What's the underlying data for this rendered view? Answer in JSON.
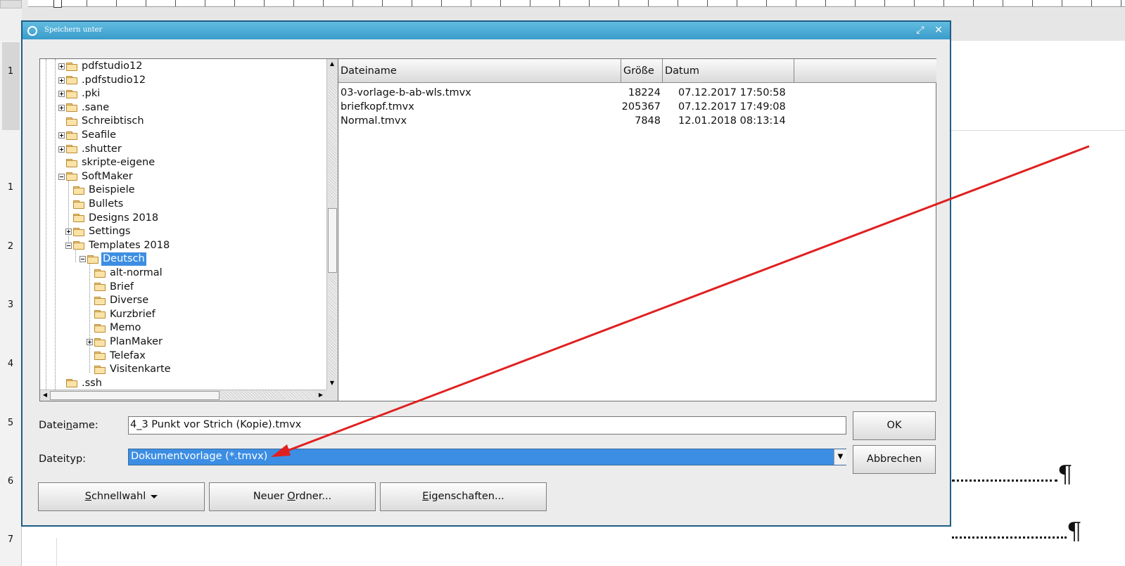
{
  "background": {
    "ruler_left_numbers": [
      "1",
      "1",
      "2",
      "3",
      "4",
      "5",
      "6",
      "7"
    ]
  },
  "dialog": {
    "title": "Speichern unter",
    "tree": {
      "items": [
        {
          "label": "pdfstudio12",
          "level": 0,
          "expander": "plus"
        },
        {
          "label": ".pdfstudio12",
          "level": 0,
          "expander": "plus"
        },
        {
          "label": ".pki",
          "level": 0,
          "expander": "plus"
        },
        {
          "label": ".sane",
          "level": 0,
          "expander": "plus"
        },
        {
          "label": "Schreibtisch",
          "level": 0,
          "expander": "none"
        },
        {
          "label": "Seafile",
          "level": 0,
          "expander": "plus"
        },
        {
          "label": ".shutter",
          "level": 0,
          "expander": "plus"
        },
        {
          "label": "skripte-eigene",
          "level": 0,
          "expander": "none"
        },
        {
          "label": "SoftMaker",
          "level": 0,
          "expander": "minus"
        },
        {
          "label": "Beispiele",
          "level": 1,
          "expander": "none"
        },
        {
          "label": "Bullets",
          "level": 1,
          "expander": "none"
        },
        {
          "label": "Designs 2018",
          "level": 1,
          "expander": "none"
        },
        {
          "label": "Settings",
          "level": 1,
          "expander": "plus"
        },
        {
          "label": "Templates 2018",
          "level": 1,
          "expander": "minus"
        },
        {
          "label": "Deutsch",
          "level": 2,
          "expander": "minus",
          "selected": true
        },
        {
          "label": "alt-normal",
          "level": 3,
          "expander": "none"
        },
        {
          "label": "Brief",
          "level": 3,
          "expander": "none"
        },
        {
          "label": "Diverse",
          "level": 3,
          "expander": "none"
        },
        {
          "label": "Kurzbrief",
          "level": 3,
          "expander": "none"
        },
        {
          "label": "Memo",
          "level": 3,
          "expander": "none"
        },
        {
          "label": "PlanMaker",
          "level": 3,
          "expander": "plus"
        },
        {
          "label": "Telefax",
          "level": 3,
          "expander": "none"
        },
        {
          "label": "Visitenkarte",
          "level": 3,
          "expander": "none"
        },
        {
          "label": ".ssh",
          "level": 0,
          "expander": "none"
        }
      ]
    },
    "filelist": {
      "columns": [
        "Dateiname",
        "Größe",
        "Datum"
      ],
      "rows": [
        {
          "name": "03-vorlage-b-ab-wls.tmvx",
          "size": "18224",
          "date": "07.12.2017 17:50:58"
        },
        {
          "name": "briefkopf.tmvx",
          "size": "205367",
          "date": "07.12.2017 17:49:08"
        },
        {
          "name": "Normal.tmvx",
          "size": "7848",
          "date": "12.01.2018 08:13:14"
        }
      ]
    },
    "form": {
      "filename_label_pre": "Datei",
      "filename_label_u": "n",
      "filename_label_post": "ame:",
      "filename_value": "4_3 Punkt vor Strich (Kopie).tmvx",
      "filetype_label": "Dateityp:",
      "filetype_value": "Dokumentvorlage (*.tmvx)"
    },
    "buttons": {
      "ok": "OK",
      "cancel": "Abbrechen",
      "quick_u": "S",
      "quick_rest": "chnellwahl",
      "newfolder_pre": "Neuer ",
      "newfolder_u": "O",
      "newfolder_post": "rdner...",
      "props_u": "E",
      "props_rest": "igenschaften..."
    }
  },
  "annotation": {
    "color": "#e02020"
  },
  "document": {
    "pilcrow": "¶"
  }
}
